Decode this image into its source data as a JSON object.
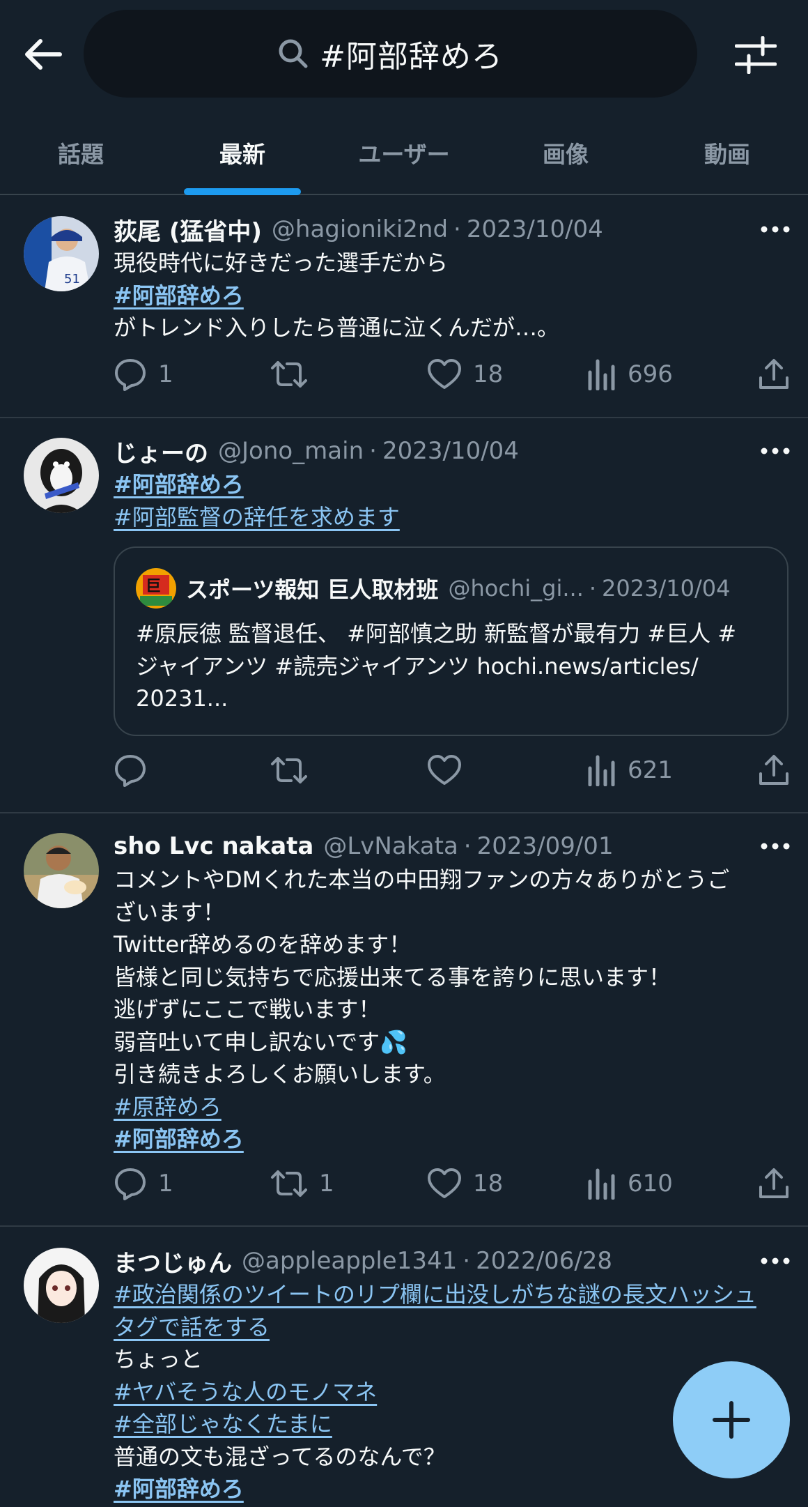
{
  "search": {
    "query": "#阿部辞めろ"
  },
  "tabs": [
    {
      "label": "話題"
    },
    {
      "label": "最新",
      "active": true
    },
    {
      "label": "ユーザー"
    },
    {
      "label": "画像"
    },
    {
      "label": "動画"
    }
  ],
  "tweets": [
    {
      "name": "荻尾 (猛省中)",
      "handle": "@hagioniki2nd",
      "date": "2023/10/04",
      "lines": [
        {
          "text": "現役時代に好きだった選手だから"
        },
        {
          "text": "#阿部辞めろ",
          "hashtag": true
        },
        {
          "text": "がトレンド入りしたら普通に泣くんだが…。"
        }
      ],
      "replies": "1",
      "retweets": "",
      "likes": "18",
      "views": "696"
    },
    {
      "name": "じょーの",
      "handle": "@Jono_main",
      "date": "2023/10/04",
      "lines": [
        {
          "text": "#阿部辞めろ",
          "hashtag": true
        },
        {
          "text": "#阿部監督の辞任を求めます",
          "hashtag": true
        }
      ],
      "quote": {
        "name": "スポーツ報知 巨人取材班",
        "handle": "@hochi_gi...",
        "date": "2023/10/04",
        "lines": [
          "#原辰徳 監督退任、 #阿部慎之助 新監督が最有力 #巨人 #",
          "ジャイアンツ #読売ジャイアンツ hochi.news/articles/",
          "20231..."
        ]
      },
      "replies": "",
      "retweets": "",
      "likes": "",
      "views": "621"
    },
    {
      "name": "sho Lvc nakata",
      "handle": "@LvNakata",
      "date": "2023/09/01",
      "lines": [
        {
          "text": "コメントやDMくれた本当の中田翔ファンの方々ありがとうご"
        },
        {
          "text": "ざいます！"
        },
        {
          "text": "Twitter辞めるのを辞めます！"
        },
        {
          "text": "皆様と同じ気持ちで応援出来てる事を誇りに思います！"
        },
        {
          "text": "逃げずにここで戦います！"
        },
        {
          "text": "弱音吐いて申し訳ないです💦"
        },
        {
          "text": "引き続きよろしくお願いします。"
        },
        {
          "text": "#原辞めろ",
          "hashtag": true
        },
        {
          "text": "#阿部辞めろ",
          "hashtag": true
        }
      ],
      "replies": "1",
      "retweets": "1",
      "likes": "18",
      "views": "610"
    },
    {
      "name": "まつじゅん",
      "handle": "@appleapple1341",
      "date": "2022/06/28",
      "lines": [
        {
          "text": "#政治関係のツイートのリプ欄に出没しがちな謎の長文ハッシュ",
          "hashtag": true
        },
        {
          "text": "タグで話をする",
          "hashtag": true
        },
        {
          "text": "ちょっと"
        },
        {
          "text": "#ヤバそうな人のモノマネ",
          "hashtag": true
        },
        {
          "text": "#全部じゃなくたまに",
          "hashtag": true
        },
        {
          "text": "普通の文も混ざってるのなんで？"
        },
        {
          "text": "#阿部辞めろ",
          "hashtag": true
        }
      ]
    }
  ],
  "colors": {
    "background": "#15202b",
    "accent": "#1d9bf0",
    "hashtag": "#8bc5f3",
    "muted": "#8b98a5",
    "fab": "#8ecdf7"
  },
  "icons": [
    "back-arrow-icon",
    "search-icon",
    "filter-sliders-icon",
    "reply-icon",
    "retweet-icon",
    "like-icon",
    "views-icon",
    "share-icon",
    "more-icon",
    "compose-plus-icon"
  ]
}
